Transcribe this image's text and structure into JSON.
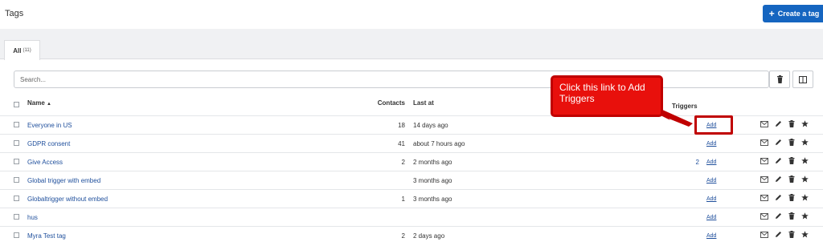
{
  "header": {
    "title": "Tags",
    "create_label": "Create a tag"
  },
  "tabs": [
    {
      "label": "All",
      "count": "(11)"
    }
  ],
  "search": {
    "placeholder": "Search..."
  },
  "columns": {
    "name": "Name",
    "contacts": "Contacts",
    "last_at": "Last at",
    "triggers": "Triggers"
  },
  "rows": [
    {
      "name": "Everyone in US",
      "contacts": "18",
      "last_at": "14 days ago",
      "triggers": "",
      "add": "Add"
    },
    {
      "name": "GDPR consent",
      "contacts": "41",
      "last_at": "about 7 hours ago",
      "triggers": "",
      "add": "Add"
    },
    {
      "name": "Give Access",
      "contacts": "2",
      "last_at": "2 months ago",
      "triggers": "2",
      "add": "Add"
    },
    {
      "name": "Global trigger with embed",
      "contacts": "",
      "last_at": "3 months ago",
      "triggers": "",
      "add": "Add"
    },
    {
      "name": "Globaltrigger without embed",
      "contacts": "1",
      "last_at": "3 months ago",
      "triggers": "",
      "add": "Add"
    },
    {
      "name": "hus",
      "contacts": "",
      "last_at": "",
      "triggers": "",
      "add": "Add"
    },
    {
      "name": "Myra Test tag",
      "contacts": "2",
      "last_at": "2 days ago",
      "triggers": "",
      "add": "Add"
    }
  ],
  "row_actions": [
    "envelope-icon",
    "pencil-icon",
    "trash-icon",
    "star-icon"
  ],
  "annotation": {
    "text": "Click this link to Add Triggers"
  },
  "colors": {
    "accent": "#1565c0",
    "link": "#1f4f9c",
    "callout": "#e8100c",
    "callout_border": "#c00000"
  }
}
